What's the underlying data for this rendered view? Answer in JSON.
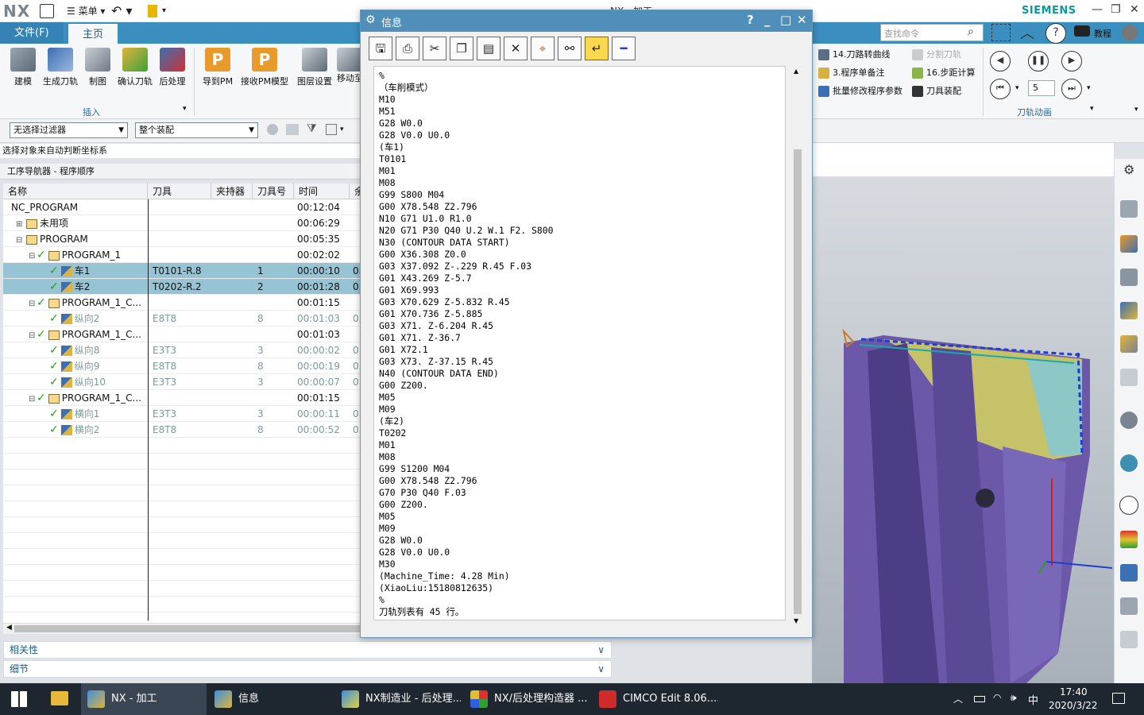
{
  "app": {
    "logo": "NX",
    "window_title": "NX - 加工",
    "brand": "SIEMENS",
    "qat_menu": "菜单"
  },
  "ribbon": {
    "tabs": [
      "文件(F)",
      "主页"
    ],
    "search_placeholder": "查找命令",
    "insert_group": {
      "label": "插入",
      "buttons": [
        "建模",
        "生成刀轨",
        "制图",
        "确认刀轨",
        "后处理",
        "导到PM",
        "接收PM模型",
        "图层设置",
        "移动至"
      ]
    },
    "right_items": [
      "14.刀路转曲线",
      "3.程序单备注",
      "批量修改程序参数",
      "分割刀轨",
      "16.步距计算",
      "刀具装配"
    ],
    "anim_group": {
      "label": "刀轨动画",
      "speed": "5"
    },
    "help_label": "教程"
  },
  "filter": {
    "selection_filter": "无选择过滤器",
    "scope": "整个装配"
  },
  "status_line": "选择对象来自动判断坐标系",
  "navigator": {
    "title": "工序导航器 - 程序顺序",
    "columns": [
      "名称",
      "刀具",
      "夹持器",
      "刀具号",
      "时间",
      "余"
    ],
    "rows": [
      {
        "name": "NC_PROGRAM",
        "tool": "",
        "num": "",
        "time": "00:12:04",
        "ext": ""
      },
      {
        "name": "未用项",
        "tool": "",
        "num": "",
        "time": "00:06:29",
        "ext": ""
      },
      {
        "name": "PROGRAM",
        "tool": "",
        "num": "",
        "time": "00:05:35",
        "ext": ""
      },
      {
        "name": "PROGRAM_1",
        "tool": "",
        "num": "",
        "time": "00:02:02",
        "ext": ""
      },
      {
        "name": "车1",
        "tool": "T0101-R.8",
        "num": "1",
        "time": "00:00:10",
        "ext": "0."
      },
      {
        "name": "车2",
        "tool": "T0202-R.2",
        "num": "2",
        "time": "00:01:28",
        "ext": "0."
      },
      {
        "name": "PROGRAM_1_C...",
        "tool": "",
        "num": "",
        "time": "00:01:15",
        "ext": ""
      },
      {
        "name": "纵向2",
        "tool": "E8T8",
        "num": "8",
        "time": "00:01:03",
        "ext": "0."
      },
      {
        "name": "PROGRAM_1_C...",
        "tool": "",
        "num": "",
        "time": "00:01:03",
        "ext": ""
      },
      {
        "name": "纵向8",
        "tool": "E3T3",
        "num": "3",
        "time": "00:00:02",
        "ext": "0."
      },
      {
        "name": "纵向9",
        "tool": "E8T8",
        "num": "8",
        "time": "00:00:19",
        "ext": "0."
      },
      {
        "name": "纵向10",
        "tool": "E3T3",
        "num": "3",
        "time": "00:00:07",
        "ext": "0."
      },
      {
        "name": "PROGRAM_1_C...",
        "tool": "",
        "num": "",
        "time": "00:01:15",
        "ext": ""
      },
      {
        "name": "横向1",
        "tool": "E3T3",
        "num": "3",
        "time": "00:00:11",
        "ext": "0."
      },
      {
        "name": "横向2",
        "tool": "E8T8",
        "num": "8",
        "time": "00:00:52",
        "ext": "0."
      }
    ]
  },
  "panels": {
    "relevance": "相关性",
    "details": "细节"
  },
  "info_dialog": {
    "title": "信息",
    "toolbar": [
      "save-icon",
      "print-icon",
      "cut-icon",
      "copy-icon",
      "paste-icon",
      "delete-icon",
      "find-icon",
      "binoculars-icon",
      "wrap-icon",
      "minus-icon"
    ],
    "lines": [
      "%",
      "（车削模式）",
      "M10",
      "M51",
      "G28 W0.0",
      "G28 V0.0 U0.0",
      "(车1)",
      "T0101",
      "M01",
      "M08",
      "G99 S800 M04",
      "G00 X78.548 Z2.796",
      "N10 G71 U1.0 R1.0",
      "N20 G71 P30 Q40 U.2 W.1 F2. S800",
      "N30 (CONTOUR DATA START)",
      "G00 X36.308 Z0.0",
      "G03 X37.092 Z-.229 R.45 F.03",
      "G01 X43.269 Z-5.7",
      "G01 X69.993",
      "G03 X70.629 Z-5.832 R.45",
      "G01 X70.736 Z-5.885",
      "G03 X71. Z-6.204 R.45",
      "G01 X71. Z-36.7",
      "G01 X72.1",
      "G03 X73. Z-37.15 R.45",
      "N40 (CONTOUR DATA END)",
      "G00 Z200.",
      "M05",
      "M09",
      "(车2)",
      "T0202",
      "M01",
      "M08",
      "G99 S1200 M04",
      "G00 X78.548 Z2.796",
      "G70 P30 Q40 F.03",
      "G00 Z200.",
      "M05",
      "M09",
      "G28 W0.0",
      "G28 V0.0 U0.0",
      "M30",
      "(Machine_Time: 4.28 Min)",
      "(XiaoLiu:15180812635)",
      "%",
      "刀轨列表有 45 行。"
    ]
  },
  "taskbar": {
    "items": [
      "NX - 加工",
      "信息",
      "NX制造业 - 后处理...",
      "NX/后处理构造器 ...",
      "CIMCO Edit 8.06...."
    ],
    "time": "17:40",
    "date": "2020/3/22",
    "ime": "中"
  }
}
